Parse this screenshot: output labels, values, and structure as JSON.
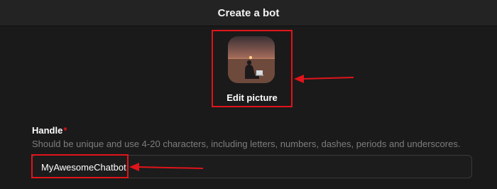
{
  "header": {
    "title": "Create a bot"
  },
  "avatar": {
    "icon": "bot-avatar-photo",
    "edit_label": "Edit picture"
  },
  "handle": {
    "label": "Handle",
    "required_mark": "*",
    "hint": "Should be unique and use 4-20 characters, including letters, numbers, dashes, periods and underscores.",
    "value": "MyAwesomeChatbot"
  },
  "colors": {
    "annotation": "#e0141a",
    "background": "#1a1a1a",
    "header": "#232323"
  }
}
